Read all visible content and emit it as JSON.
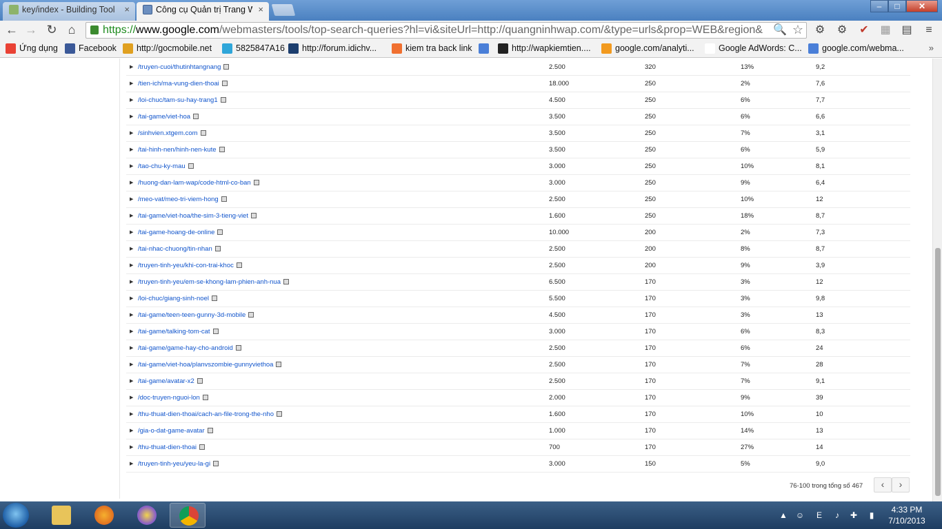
{
  "browser": {
    "tabs": [
      {
        "title": "key/index - Building Tool",
        "close": "×"
      },
      {
        "title": "Công cụ Quản trị Trang W",
        "close": "×"
      }
    ],
    "url": {
      "scheme": "https://",
      "domain": "www.google.com",
      "path": "/webmasters/tools/top-search-queries?hl=vi&siteUrl=http://quangninhwap.com/&type=urls&prop=WEB&region&"
    },
    "window_controls": {
      "minimize": "–",
      "maximize": "□",
      "close": "✕"
    },
    "nav": {
      "back": "←",
      "forward": "→",
      "reload": "↻",
      "home": "⌂"
    },
    "bookmarks": [
      {
        "label": "Ứng dụng",
        "color": "#e94235"
      },
      {
        "label": "Facebook",
        "color": "#3b5998"
      },
      {
        "label": "http://gocmobile.net",
        "color": "#e0a020"
      },
      {
        "label": "5825847A16",
        "color": "#2fa6d9"
      },
      {
        "label": "http://forum.idichv...",
        "color": "#1c3e6e"
      },
      {
        "label": "kiem tra back link",
        "color": "#f07030"
      },
      {
        "label": "",
        "color": "#4a7fd8"
      },
      {
        "label": "http://wapkiemtien....",
        "color": "#222222"
      },
      {
        "label": "google.com/analyti...",
        "color": "#f29a1f"
      },
      {
        "label": "Google AdWords: C...",
        "color": "#ffffff"
      },
      {
        "label": "google.com/webma...",
        "color": "#4a7fd8"
      }
    ],
    "bookmarks_more": "»"
  },
  "table": {
    "rows": [
      {
        "url": "/truyen-cuoi/thutinhtangnang",
        "c1": "2.500",
        "c2": "320",
        "c3": "13%",
        "c4": "9,2"
      },
      {
        "url": "/tien-ich/ma-vung-dien-thoai",
        "c1": "18.000",
        "c2": "250",
        "c3": "2%",
        "c4": "7,6"
      },
      {
        "url": "/loi-chuc/tam-su-hay-trang1",
        "c1": "4.500",
        "c2": "250",
        "c3": "6%",
        "c4": "7,7"
      },
      {
        "url": "/tai-game/viet-hoa",
        "c1": "3.500",
        "c2": "250",
        "c3": "6%",
        "c4": "6,6"
      },
      {
        "url": "/sinhvien.xtgem.com",
        "c1": "3.500",
        "c2": "250",
        "c3": "7%",
        "c4": "3,1"
      },
      {
        "url": "/tai-hinh-nen/hinh-nen-kute",
        "c1": "3.500",
        "c2": "250",
        "c3": "6%",
        "c4": "5,9"
      },
      {
        "url": "/tao-chu-ky-mau",
        "c1": "3.000",
        "c2": "250",
        "c3": "10%",
        "c4": "8,1"
      },
      {
        "url": "/huong-dan-lam-wap/code-html-co-ban",
        "c1": "3.000",
        "c2": "250",
        "c3": "9%",
        "c4": "6,4"
      },
      {
        "url": "/meo-vat/meo-tri-viem-hong",
        "c1": "2.500",
        "c2": "250",
        "c3": "10%",
        "c4": "12"
      },
      {
        "url": "/tai-game/viet-hoa/the-sim-3-tieng-viet",
        "c1": "1.600",
        "c2": "250",
        "c3": "18%",
        "c4": "8,7"
      },
      {
        "url": "/tai-game-hoang-de-online",
        "c1": "10.000",
        "c2": "200",
        "c3": "2%",
        "c4": "7,3"
      },
      {
        "url": "/tai-nhac-chuong/tin-nhan",
        "c1": "2.500",
        "c2": "200",
        "c3": "8%",
        "c4": "8,7"
      },
      {
        "url": "/truyen-tinh-yeu/khi-con-trai-khoc",
        "c1": "2.500",
        "c2": "200",
        "c3": "9%",
        "c4": "3,9"
      },
      {
        "url": "/truyen-tinh-yeu/em-se-khong-lam-phien-anh-nua",
        "c1": "6.500",
        "c2": "170",
        "c3": "3%",
        "c4": "12"
      },
      {
        "url": "/loi-chuc/giang-sinh-noel",
        "c1": "5.500",
        "c2": "170",
        "c3": "3%",
        "c4": "9,8"
      },
      {
        "url": "/tai-game/teen-teen-gunny-3d-mobile",
        "c1": "4.500",
        "c2": "170",
        "c3": "3%",
        "c4": "13"
      },
      {
        "url": "/tai-game/talking-tom-cat",
        "c1": "3.000",
        "c2": "170",
        "c3": "6%",
        "c4": "8,3"
      },
      {
        "url": "/tai-game/game-hay-cho-android",
        "c1": "2.500",
        "c2": "170",
        "c3": "6%",
        "c4": "24"
      },
      {
        "url": "/tai-game/viet-hoa/planvszombie-gunnyviethoa",
        "c1": "2.500",
        "c2": "170",
        "c3": "7%",
        "c4": "28"
      },
      {
        "url": "/tai-game/avatar-x2",
        "c1": "2.500",
        "c2": "170",
        "c3": "7%",
        "c4": "9,1"
      },
      {
        "url": "/doc-truyen-nguoi-lon",
        "c1": "2.000",
        "c2": "170",
        "c3": "9%",
        "c4": "39"
      },
      {
        "url": "/thu-thuat-dien-thoai/cach-an-file-trong-the-nho",
        "c1": "1.600",
        "c2": "170",
        "c3": "10%",
        "c4": "10"
      },
      {
        "url": "/gia-o-dat-game-avatar",
        "c1": "1.000",
        "c2": "170",
        "c3": "14%",
        "c4": "13"
      },
      {
        "url": "/thu-thuat-dien-thoai",
        "c1": "700",
        "c2": "170",
        "c3": "27%",
        "c4": "14"
      },
      {
        "url": "/truyen-tinh-yeu/yeu-la-gi",
        "c1": "3.000",
        "c2": "150",
        "c3": "5%",
        "c4": "9,0"
      }
    ]
  },
  "pager": {
    "text": "76-100 trong tổng số 467",
    "prev": "‹",
    "next": "›"
  },
  "taskbar": {
    "apps": [
      {
        "name": "explorer",
        "color": "#e8c45a"
      },
      {
        "name": "firefox",
        "color": "#e76f1e"
      },
      {
        "name": "yahoo-messenger",
        "color": "#8a5fc8"
      },
      {
        "name": "chrome",
        "color": "#4285f4"
      }
    ],
    "clock_time": "4:33 PM",
    "clock_date": "7/10/2013"
  }
}
